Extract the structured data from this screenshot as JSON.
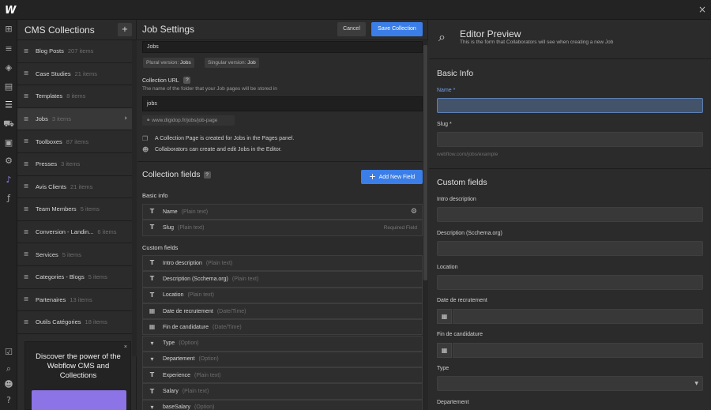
{
  "app": {
    "logo": "W",
    "close": "×"
  },
  "rail": [
    "add-icon",
    "navigator-icon",
    "components-icon",
    "pages-icon",
    "cms-icon",
    "ecommerce-icon",
    "assets-icon",
    "settings-icon",
    "logic-icon",
    "finsweet-icon",
    "audit-icon",
    "search-icon",
    "users-icon",
    "help-icon"
  ],
  "cms": {
    "title": "CMS Collections",
    "add_icon": "+",
    "items": [
      {
        "name": "Blog Posts",
        "count": "207 items"
      },
      {
        "name": "Case Studies",
        "count": "21 items"
      },
      {
        "name": "Templates",
        "count": "8 items"
      },
      {
        "name": "Jobs",
        "count": "3 items",
        "selected": true
      },
      {
        "name": "Toolboxes",
        "count": "87 items"
      },
      {
        "name": "Presses",
        "count": "3 items"
      },
      {
        "name": "Avis Clients",
        "count": "21 items"
      },
      {
        "name": "Team Members",
        "count": "5 items"
      },
      {
        "name": "Conversion - Landin...",
        "count": "6 items"
      },
      {
        "name": "Services",
        "count": "5 items"
      },
      {
        "name": "Categories - Blogs",
        "count": "5 items"
      },
      {
        "name": "Partenaires",
        "count": "13 items"
      },
      {
        "name": "Outils Catégories",
        "count": "18 items"
      }
    ],
    "promo": {
      "text": "Discover the power of the Webflow CMS and Collections",
      "close": "×"
    }
  },
  "job": {
    "title": "Job Settings",
    "cancel": "Cancel",
    "save": "Save Collection",
    "name_value": "Jobs",
    "plural_label": "Plural version:",
    "plural_value": "Jobs",
    "singular_label": "Singular version:",
    "singular_value": "Job",
    "url_label": "Collection URL",
    "url_help": "The name of the folder that your Job pages will be stored in",
    "url_value": "jobs",
    "url_preview": "www.digidop.fr/jobs/job-page",
    "note1": "A Collection Page is created for Jobs in the Pages panel.",
    "note2": "Collaborators can create and edit Jobs in the Editor.",
    "fields_title": "Collection fields",
    "add_field": "Add New Field",
    "basic_info": "Basic info",
    "basic_fields": [
      {
        "name": "Name",
        "type": "(Plain text)",
        "icon": "T"
      },
      {
        "name": "Slug",
        "type": "(Plain text)",
        "icon": "T",
        "right": "Required Field"
      }
    ],
    "custom_title": "Custom fields",
    "custom_fields": [
      {
        "name": "Intro description",
        "type": "(Plain text)",
        "icon": "T"
      },
      {
        "name": "Description (Scchema.org)",
        "type": "(Plain text)",
        "icon": "T"
      },
      {
        "name": "Location",
        "type": "(Plain text)",
        "icon": "T"
      },
      {
        "name": "Date de recrutement",
        "type": "(Date/Time)",
        "icon": "▦"
      },
      {
        "name": "Fin de candidature",
        "type": "(Date/Time)",
        "icon": "▦"
      },
      {
        "name": "Type",
        "type": "(Option)",
        "icon": "▾"
      },
      {
        "name": "Departement",
        "type": "(Option)",
        "icon": "▾"
      },
      {
        "name": "Experience",
        "type": "(Plain text)",
        "icon": "T"
      },
      {
        "name": "Salary",
        "type": "(Plain text)",
        "icon": "T"
      },
      {
        "name": "baseSalary",
        "type": "(Option)",
        "icon": "▾"
      }
    ]
  },
  "preview": {
    "title": "Editor Preview",
    "subtitle": "This is the form that Collaborators will see when creating a new Job",
    "basic_title": "Basic Info",
    "name_label": "Name *",
    "slug_label": "Slug *",
    "slug_hint": "webflow.com/jobs/example",
    "custom_title": "Custom fields",
    "labels": [
      "Intro description",
      "Description (Scchema.org)",
      "Location",
      "Date de recrutement",
      "Fin de candidature",
      "Type",
      "Departement"
    ]
  }
}
